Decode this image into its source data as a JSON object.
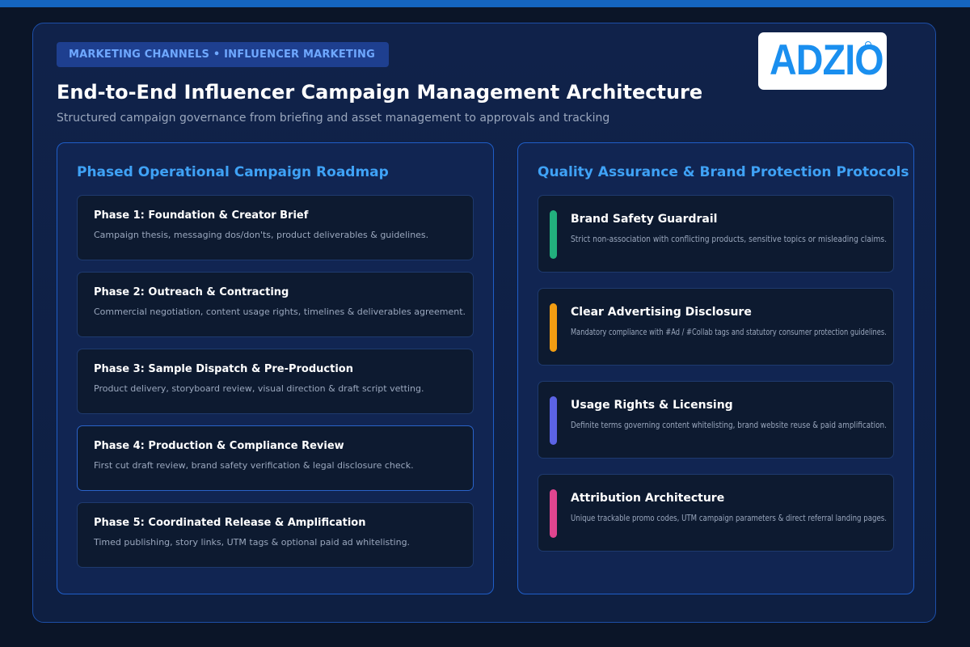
{
  "header": {
    "tag": "MARKETING CHANNELS • INFLUENCER MARKETING",
    "title": "End-to-End Influencer Campaign Management Architecture",
    "subtitle": "Structured campaign governance from briefing and asset management to approvals and tracking"
  },
  "logo": {
    "text": "ADZIO",
    "color": "#1a8fef"
  },
  "roadmap": {
    "title": "Phased Operational Campaign Roadmap",
    "phases": [
      {
        "title": "Phase 1: Foundation & Creator Brief",
        "desc": "Campaign thesis, messaging dos/don'ts, product deliverables & guidelines."
      },
      {
        "title": "Phase 2: Outreach & Contracting",
        "desc": "Commercial negotiation, content usage rights, timelines & deliverables agreement."
      },
      {
        "title": "Phase 3: Sample Dispatch & Pre-Production",
        "desc": "Product delivery, storyboard review, visual direction & draft script vetting."
      },
      {
        "title": "Phase 4: Production & Compliance Review",
        "desc": "First cut draft review, brand safety verification & legal disclosure check."
      },
      {
        "title": "Phase 5: Coordinated Release & Amplification",
        "desc": "Timed publishing, story links, UTM tags & optional paid ad whitelisting."
      }
    ]
  },
  "protocols": {
    "title": "Quality Assurance & Brand Protection Protocols",
    "items": [
      {
        "title": "Brand Safety Guardrail",
        "desc": "Strict non-association with conflicting products, sensitive topics or misleading claims.",
        "color": "#22b07d"
      },
      {
        "title": "Clear Advertising Disclosure",
        "desc": "Mandatory compliance with #Ad / #Collab tags and statutory consumer protection guidelines.",
        "color": "#f29d12"
      },
      {
        "title": "Usage Rights & Licensing",
        "desc": "Definite terms governing content whitelisting, brand website reuse & paid amplification.",
        "color": "#5b63e6"
      },
      {
        "title": "Attribution Architecture",
        "desc": "Unique trackable promo codes, UTM campaign parameters & direct referral landing pages.",
        "color": "#e0458f"
      }
    ]
  }
}
